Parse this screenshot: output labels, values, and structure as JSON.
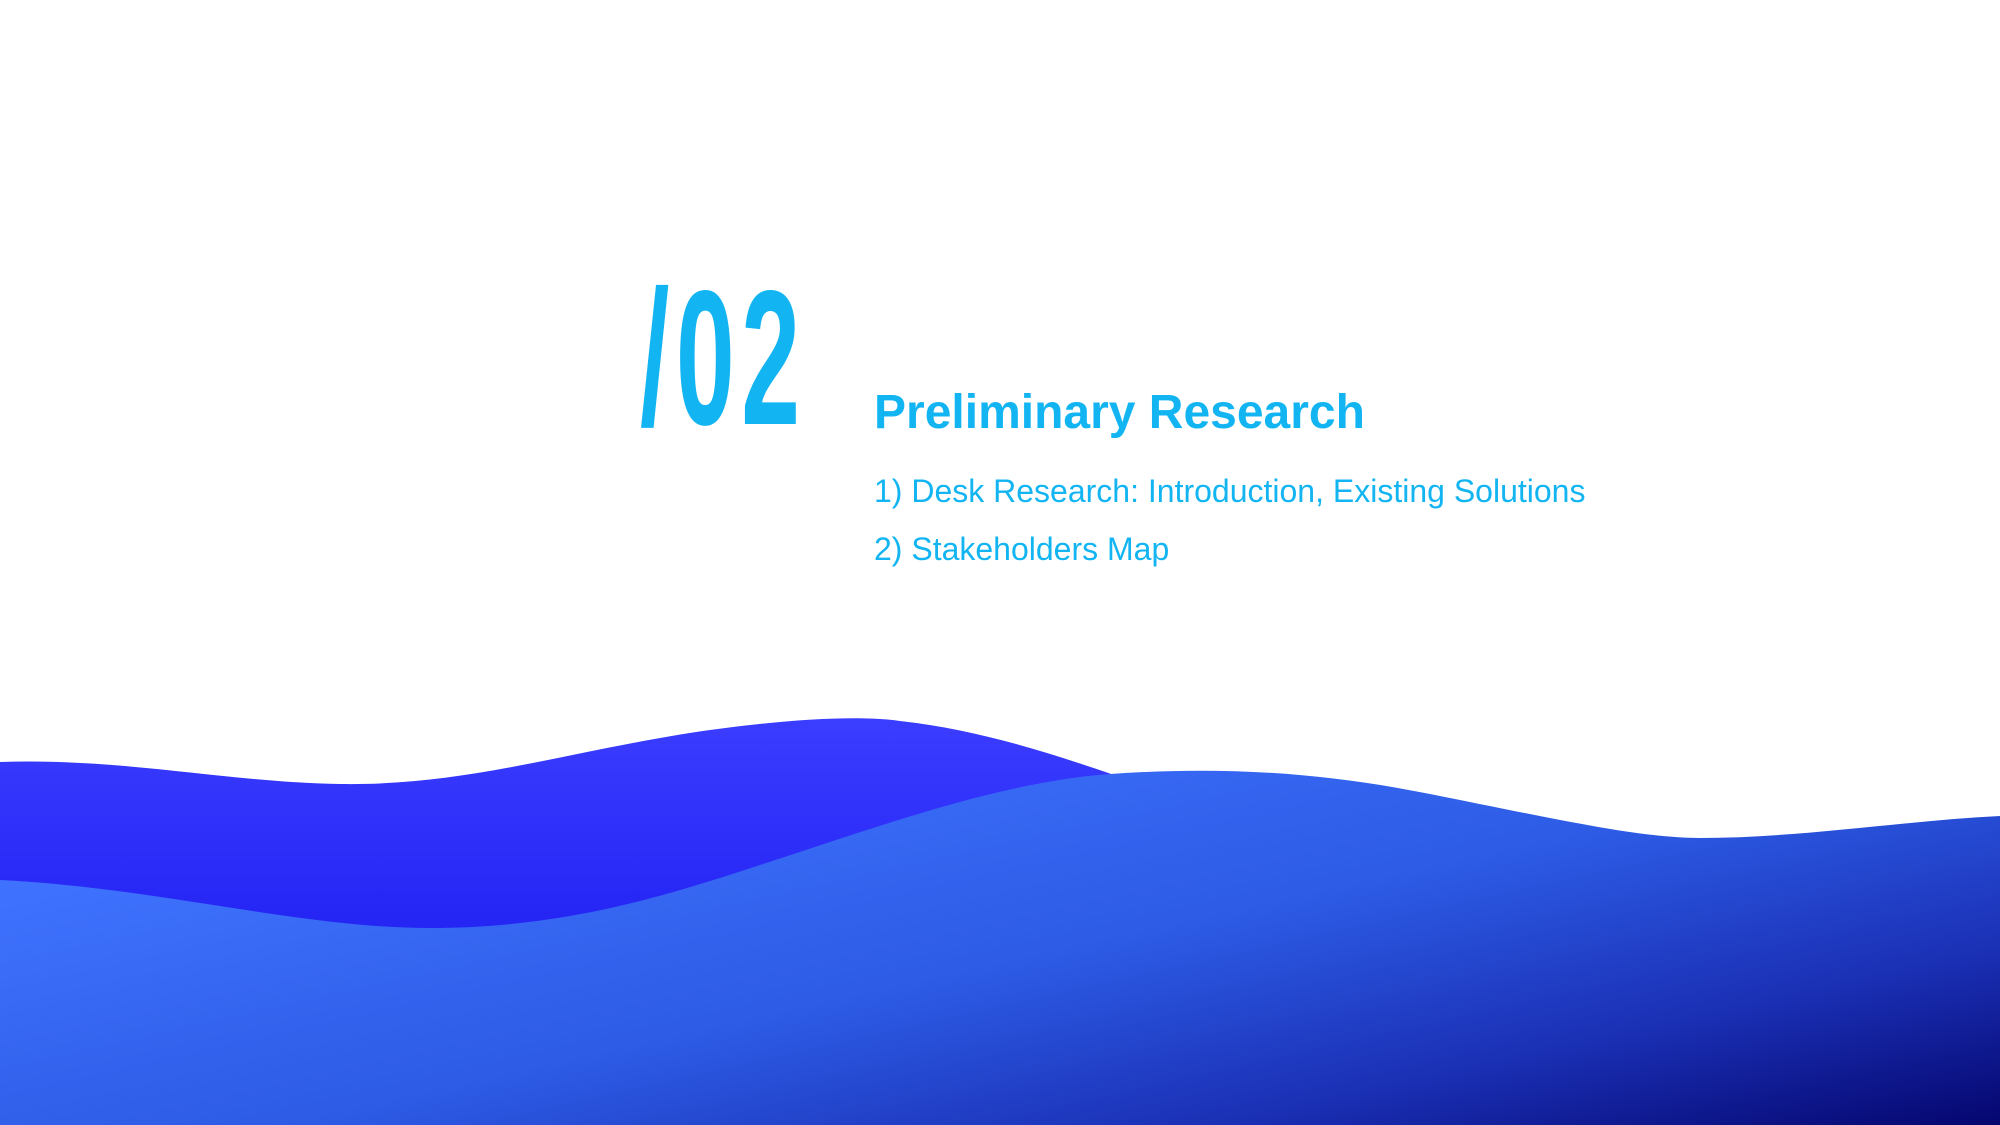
{
  "slide": {
    "number": "/02",
    "title": "Preliminary Research",
    "items": [
      "1) Desk Research: Introduction, Existing Solutions",
      "2) Stakeholders Map"
    ]
  },
  "colors": {
    "text_accent": "#12b5f2",
    "wave_back_light": "#3b3dff",
    "wave_back_mid": "#2323f3",
    "wave_back_dark": "#1414b8",
    "wave_front_light": "#3f73ff",
    "wave_front_dark": "#05066f",
    "background": "#ffffff"
  }
}
